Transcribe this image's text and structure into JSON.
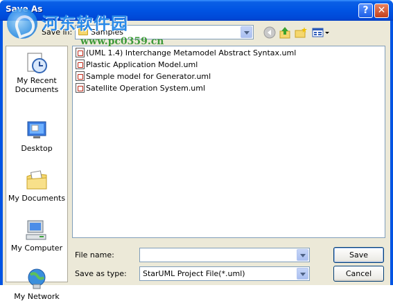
{
  "window": {
    "title": "Save As",
    "help_label": "?",
    "close_label": "✕"
  },
  "watermark": {
    "chinese_text": "河东软件园",
    "url": "www.pc0359.cn"
  },
  "toolbar": {
    "save_in_label": "Save in:",
    "save_in_value": "Samples",
    "back_icon": "back-arrow-icon",
    "up_icon": "up-folder-icon",
    "new_folder_icon": "new-folder-icon",
    "views_icon": "views-menu-icon"
  },
  "places": [
    {
      "label": "My Recent Documents",
      "icon": "recent-documents-icon"
    },
    {
      "label": "Desktop",
      "icon": "desktop-icon"
    },
    {
      "label": "My Documents",
      "icon": "my-documents-icon"
    },
    {
      "label": "My Computer",
      "icon": "my-computer-icon"
    },
    {
      "label": "My Network",
      "icon": "my-network-icon"
    }
  ],
  "files": [
    "(UML 1.4) Interchange Metamodel Abstract Syntax.uml",
    "Plastic Application Model.uml",
    "Sample model for Generator.uml",
    "Satellite Operation System.uml"
  ],
  "form": {
    "file_name_label": "File name:",
    "file_name_value": "",
    "save_type_label": "Save as type:",
    "save_type_value": "StarUML Project File(*.uml)",
    "save_button": "Save",
    "cancel_button": "Cancel"
  },
  "colors": {
    "title_bar": "#0054e3",
    "dialog_face": "#ece9d8",
    "close_button": "#c3401c"
  }
}
